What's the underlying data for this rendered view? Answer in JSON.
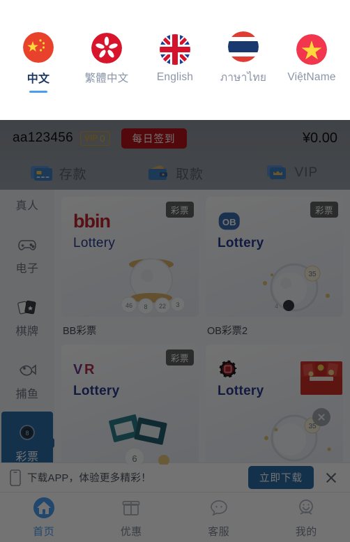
{
  "language_panel": {
    "items": [
      {
        "label": "中文",
        "flag": "flag-china",
        "active": true
      },
      {
        "label": "繁體中文",
        "flag": "flag-hongkong",
        "active": false
      },
      {
        "label": "English",
        "flag": "flag-uk",
        "active": false
      },
      {
        "label": "ภาษาไทย",
        "flag": "flag-thailand",
        "active": false
      },
      {
        "label": "ViệtName",
        "flag": "flag-vietnam",
        "active": false
      }
    ],
    "active_underline_color": "#4b9df0",
    "active_text_color": "#1f3864",
    "inactive_text_color": "#8a96a8"
  },
  "header": {
    "username": "aa123456",
    "vip_label": "VIP",
    "vip_level": "0",
    "signin_label": "每日签到",
    "balance": "¥0.00",
    "signin_color": "#b8121a",
    "vip_color": "#c9a24a",
    "quick_actions": [
      {
        "label": "存款",
        "icon": "credit-card-icon"
      },
      {
        "label": "取款",
        "icon": "wallet-icon"
      },
      {
        "label": "VIP",
        "icon": "crown-icon"
      }
    ]
  },
  "sidebar": {
    "items": [
      {
        "label": "真人",
        "icon": "person-icon",
        "active": false
      },
      {
        "label": "电子",
        "icon": "gamepad-icon",
        "active": false
      },
      {
        "label": "棋牌",
        "icon": "cards-icon",
        "active": false
      },
      {
        "label": "捕鱼",
        "icon": "fish-icon",
        "active": false
      },
      {
        "label": "彩票",
        "icon": "lottery-ball-icon",
        "active": true
      }
    ],
    "active_color": "#2e6ea8"
  },
  "games": {
    "cards": [
      {
        "name": "BB彩票",
        "badge": "彩票",
        "brand": "bbin",
        "brand_sub": "Lottery",
        "brand_style": "bbin",
        "art": "lottery-machine"
      },
      {
        "name": "OB彩票2",
        "badge": "彩票",
        "brand": "OB",
        "brand_sub": "Lottery",
        "brand_style": "ob",
        "art": "lottery-drum"
      },
      {
        "name": "",
        "badge": "彩票",
        "brand": "VR",
        "brand_sub": "Lottery",
        "brand_style": "vr",
        "art": "lottery-tickets"
      },
      {
        "name": "",
        "badge": "",
        "brand": "chip",
        "brand_sub": "Lottery",
        "brand_style": "chip",
        "art": "lottery-drum"
      }
    ]
  },
  "promo": {
    "icon": "gift-box-icon",
    "close_icon": "close-icon"
  },
  "download_bar": {
    "icon": "phone-icon",
    "text": "下载APP，体验更多精彩！",
    "button_label": "立即下载",
    "close_icon": "close-icon",
    "button_color": "#2e6ea8"
  },
  "tabbar": {
    "items": [
      {
        "label": "首页",
        "icon": "home-icon",
        "active": true
      },
      {
        "label": "优惠",
        "icon": "gift-icon",
        "active": false
      },
      {
        "label": "客服",
        "icon": "chat-icon",
        "active": false
      },
      {
        "label": "我的",
        "icon": "smiley-icon",
        "active": false
      }
    ],
    "active_color": "#4b9df0",
    "inactive_color": "#7e8794"
  }
}
